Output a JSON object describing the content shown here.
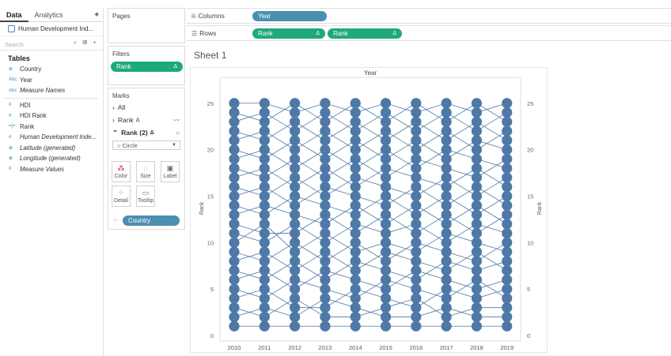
{
  "left_pane": {
    "tabs": [
      "Data",
      "Analytics"
    ],
    "tab_arrows": "◆",
    "datasource": "Human Development Ind...",
    "search_placeholder": "Search",
    "tables_title": "Tables",
    "fields": [
      {
        "icon": "globe-icon",
        "glyph": "⊕",
        "color": "blue",
        "label": "Country",
        "italic": false
      },
      {
        "icon": "abc-icon",
        "glyph": "Abc",
        "color": "blue",
        "label": "Year",
        "italic": false
      },
      {
        "icon": "abc-icon",
        "glyph": "Abc",
        "color": "blue",
        "label": "Measure Names",
        "italic": true
      }
    ],
    "measures": [
      {
        "icon": "hash-icon",
        "glyph": "#",
        "color": "green",
        "label": "HDI",
        "italic": false
      },
      {
        "icon": "hash-icon",
        "glyph": "#",
        "color": "green",
        "label": "HDI Rank",
        "italic": false
      },
      {
        "icon": "bin-icon",
        "glyph": "=|+",
        "color": "green",
        "label": "Rank",
        "italic": false
      },
      {
        "icon": "hash-icon",
        "glyph": "#",
        "color": "green",
        "label": "Human Development Inde...",
        "italic": true
      },
      {
        "icon": "globe-icon",
        "glyph": "⊕",
        "color": "green",
        "label": "Latitude (generated)",
        "italic": true
      },
      {
        "icon": "globe-icon",
        "glyph": "⊕",
        "color": "green",
        "label": "Longitude (generated)",
        "italic": true
      },
      {
        "icon": "hash-icon",
        "glyph": "#",
        "color": "green",
        "label": "Measure Values",
        "italic": true
      }
    ]
  },
  "pages_card": {
    "title": "Pages"
  },
  "filters_card": {
    "title": "Filters",
    "pill": "Rank",
    "pill_icon": "Δ"
  },
  "marks_card": {
    "title": "Marks",
    "all": "All",
    "rank": "Rank",
    "rank2": "Rank (2)",
    "delta": "Δ",
    "mark_type": "Circle",
    "buttons": [
      "Color",
      "Size",
      "Label",
      "Detail",
      "Tooltip"
    ],
    "detail_pill": "Country"
  },
  "shelves": {
    "columns_label": "Columns",
    "columns_pill": "Year",
    "rows_label": "Rows",
    "rows_pills": [
      "Rank",
      "Rank"
    ],
    "delta": "Δ"
  },
  "sheet": {
    "title": "Sheet 1",
    "column_header": "Year"
  },
  "colors": {
    "mark": "#4e79a7",
    "green_pill": "#1ea97c",
    "blue_pill": "#4b8fb0"
  },
  "chart_data": {
    "type": "scatter",
    "subtype": "bump chart with connecting lines",
    "x": [
      "2010",
      "2011",
      "2012",
      "2013",
      "2014",
      "2015",
      "2016",
      "2017",
      "2018",
      "2019"
    ],
    "ylabel": "Rank",
    "ylabel_right": "Rank",
    "ylim": [
      0,
      26
    ],
    "yticks": [
      0,
      5,
      10,
      15,
      20,
      25
    ],
    "points_per_year_ranks": [
      1,
      2,
      3,
      4,
      5,
      6,
      7,
      8,
      9,
      10,
      11,
      12,
      13,
      14,
      15,
      16,
      17,
      18,
      19,
      20,
      21,
      22,
      23,
      24,
      25
    ],
    "series_count": 25,
    "series": [
      {
        "values": [
          1,
          1,
          1,
          1,
          1,
          1,
          1,
          1,
          1,
          1
        ]
      },
      {
        "values": [
          2,
          3,
          2,
          4,
          3,
          2,
          2,
          3,
          2,
          2
        ]
      },
      {
        "values": [
          3,
          2,
          4,
          2,
          2,
          3,
          4,
          2,
          3,
          3
        ]
      },
      {
        "values": [
          4,
          5,
          3,
          3,
          5,
          4,
          3,
          5,
          4,
          5
        ]
      },
      {
        "values": [
          5,
          4,
          6,
          5,
          4,
          6,
          5,
          4,
          6,
          4
        ]
      },
      {
        "values": [
          6,
          7,
          5,
          7,
          6,
          5,
          7,
          6,
          5,
          6
        ]
      },
      {
        "values": [
          7,
          6,
          8,
          6,
          8,
          7,
          6,
          8,
          7,
          8
        ]
      },
      {
        "values": [
          8,
          9,
          7,
          9,
          7,
          9,
          8,
          7,
          9,
          7
        ]
      },
      {
        "values": [
          9,
          8,
          10,
          8,
          10,
          8,
          10,
          9,
          8,
          10
        ]
      },
      {
        "values": [
          10,
          12,
          9,
          11,
          9,
          10,
          9,
          11,
          10,
          9
        ]
      },
      {
        "values": [
          11,
          10,
          12,
          10,
          12,
          11,
          12,
          10,
          12,
          11
        ]
      },
      {
        "values": [
          12,
          11,
          11,
          13,
          11,
          13,
          11,
          13,
          11,
          13
        ]
      },
      {
        "values": [
          13,
          14,
          13,
          12,
          14,
          12,
          14,
          12,
          14,
          12
        ]
      },
      {
        "values": [
          14,
          13,
          15,
          14,
          13,
          15,
          13,
          15,
          13,
          15
        ]
      },
      {
        "values": [
          15,
          16,
          14,
          16,
          15,
          14,
          16,
          14,
          16,
          14
        ]
      },
      {
        "values": [
          16,
          15,
          17,
          15,
          17,
          16,
          15,
          17,
          15,
          17
        ]
      },
      {
        "values": [
          17,
          18,
          16,
          18,
          16,
          18,
          17,
          16,
          18,
          16
        ]
      },
      {
        "values": [
          18,
          17,
          19,
          17,
          19,
          17,
          19,
          18,
          17,
          19
        ]
      },
      {
        "values": [
          19,
          20,
          18,
          20,
          18,
          20,
          18,
          20,
          19,
          18
        ]
      },
      {
        "values": [
          20,
          19,
          21,
          19,
          21,
          19,
          21,
          19,
          21,
          20
        ]
      },
      {
        "values": [
          21,
          22,
          20,
          22,
          20,
          22,
          20,
          22,
          20,
          22
        ]
      },
      {
        "values": [
          22,
          21,
          23,
          21,
          23,
          21,
          23,
          21,
          23,
          21
        ]
      },
      {
        "values": [
          23,
          24,
          22,
          24,
          22,
          24,
          22,
          24,
          22,
          24
        ]
      },
      {
        "values": [
          24,
          23,
          25,
          23,
          25,
          23,
          25,
          23,
          25,
          23
        ]
      },
      {
        "values": [
          25,
          25,
          24,
          25,
          24,
          25,
          24,
          25,
          24,
          25
        ]
      }
    ],
    "grid": false,
    "legend": "none"
  }
}
